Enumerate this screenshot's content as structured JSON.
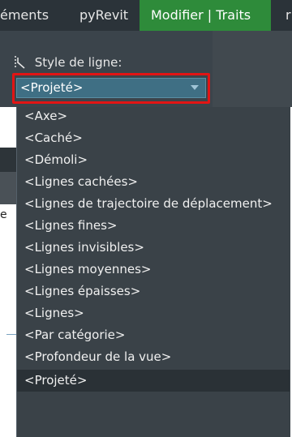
{
  "tabs": [
    {
      "label": "éments"
    },
    {
      "label": "pyRevit"
    },
    {
      "label": "Modifier | Traits"
    },
    {
      "label": "r"
    }
  ],
  "properties": {
    "style_label": "Style de ligne:",
    "style_icon": "line-style-icon",
    "selected_value": "<Projeté>"
  },
  "background_fragment": "e",
  "dropdown": {
    "items": [
      "<Axe>",
      "<Caché>",
      "<Démoli>",
      "<Lignes cachées>",
      "<Lignes de trajectoire de déplacement>",
      "<Lignes fines>",
      "<Lignes invisibles>",
      "<Lignes moyennes>",
      "<Lignes épaisses>",
      "<Lignes>",
      "<Par catégorie>",
      "<Profondeur de la vue>",
      "<Projeté>"
    ],
    "selected_index": 12
  },
  "colors": {
    "active_tab": "#2e8b3a",
    "highlight_box": "#e21414",
    "combo_bg": "#3f6f84",
    "dropdown_bg": "#3a4248"
  }
}
